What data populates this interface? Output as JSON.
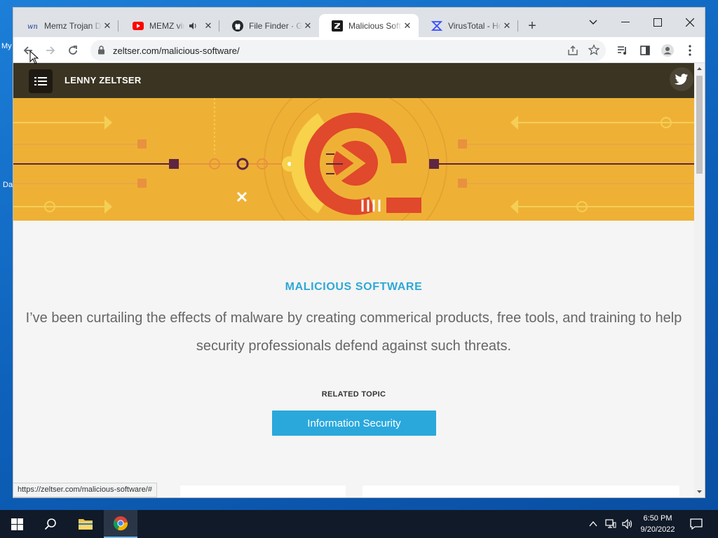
{
  "desktop": {
    "icon_labels": [
      "My",
      "Da"
    ]
  },
  "browser": {
    "tabs": [
      {
        "favicon": "wn-icon",
        "label": "Memz Trojan D",
        "muted": false
      },
      {
        "favicon": "youtube-icon",
        "label": "MEMZ virus",
        "audio": true
      },
      {
        "favicon": "github-icon",
        "label": "File Finder · GitHub"
      },
      {
        "favicon": "zeltser-z-icon",
        "label": "Malicious Software",
        "active": true
      },
      {
        "favicon": "virustotal-icon",
        "label": "VirusTotal - Home"
      }
    ],
    "new_tab_label": "+",
    "address": {
      "url": "zeltser.com/malicious-software/"
    }
  },
  "site": {
    "name": "LENNY ZELTSER",
    "section_title": "MALICIOUS SOFTWARE",
    "intro": "I’ve been curtailing the effects of malware by creating commerical products, free tools, and training to help security professionals defend against such threats.",
    "related_label": "RELATED TOPIC",
    "related_button": "Information Security"
  },
  "status_url": "https://zeltser.com/malicious-software/#",
  "taskbar": {
    "time": "6:50 PM",
    "date": "9/20/2022"
  },
  "colors": {
    "banner": "#eeb136",
    "accent": "#2ea8d6",
    "button": "#2aa8dc",
    "sitebar": "#3b3422"
  }
}
